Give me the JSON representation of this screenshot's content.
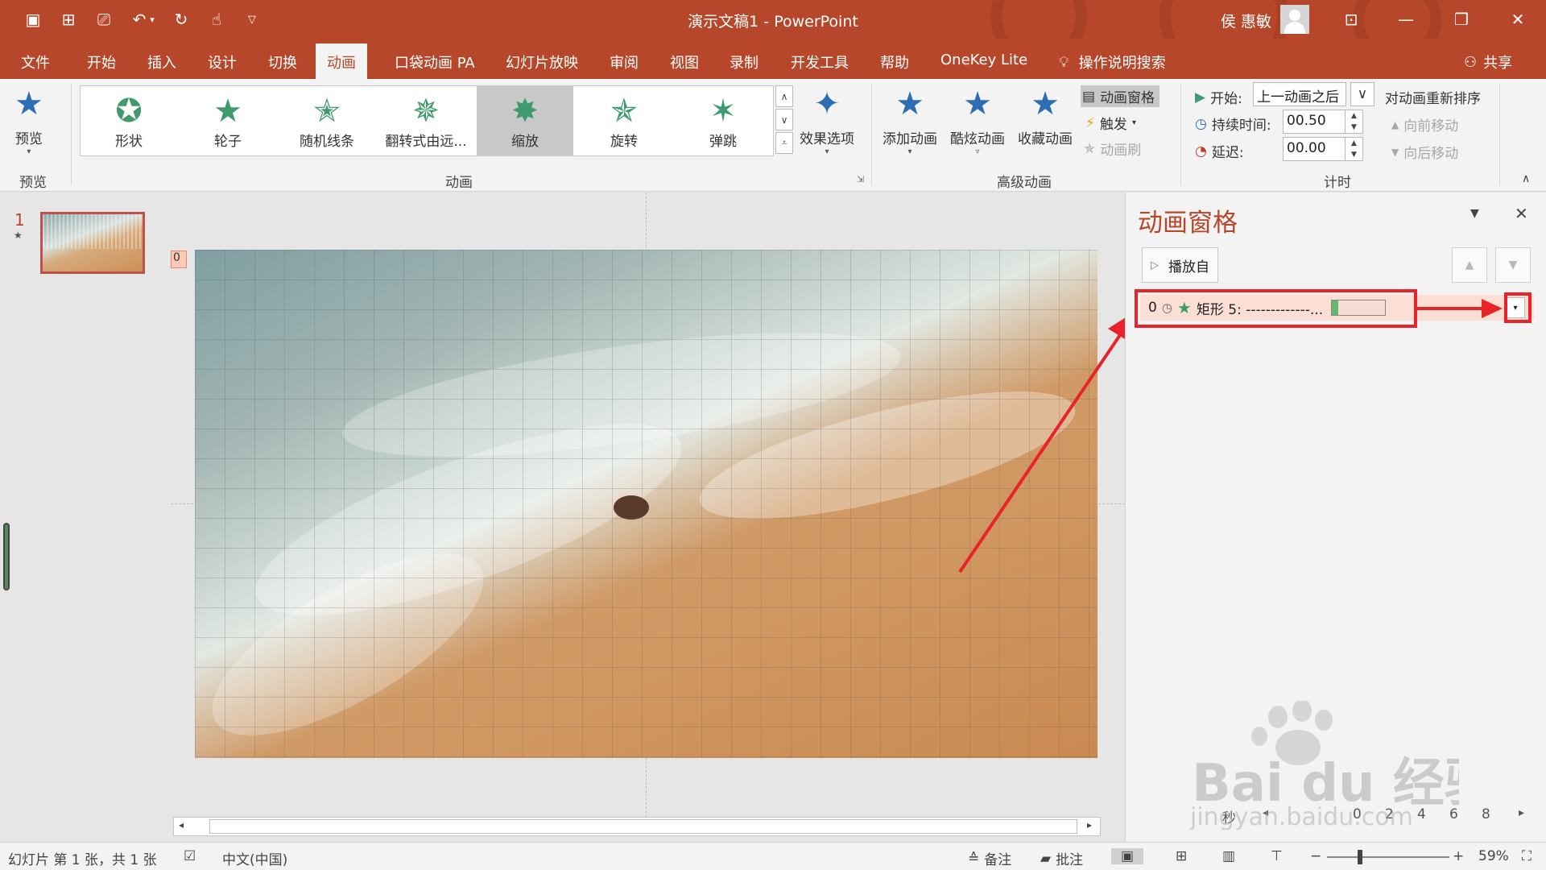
{
  "window": {
    "title": "演示文稿1 - PowerPoint",
    "user": "侯 惠敏"
  },
  "menu": {
    "tabs": [
      "文件",
      "开始",
      "插入",
      "设计",
      "切换",
      "动画",
      "口袋动画 PA",
      "幻灯片放映",
      "审阅",
      "视图",
      "录制",
      "开发工具",
      "帮助",
      "OneKey Lite"
    ],
    "active": "动画",
    "search": "操作说明搜索",
    "share": "共享"
  },
  "ribbon": {
    "preview_label": "预览",
    "preview_group": "预览",
    "gallery": [
      "形状",
      "轮子",
      "随机线条",
      "翻转式由远...",
      "缩放",
      "旋转",
      "弹跳"
    ],
    "gallery_selected": "缩放",
    "effect_options": "效果选项",
    "animation_group": "动画",
    "add_animation": "添加动画",
    "cool_animation": "酷炫动画",
    "fav_animation": "收藏动画",
    "anim_pane_btn": "动画窗格",
    "trigger": "触发",
    "anim_brush": "动画刷",
    "advanced_group": "高级动画",
    "start_label": "开始:",
    "start_value": "上一动画之后",
    "duration_label": "持续时间:",
    "duration_value": "00.50",
    "delay_label": "延迟:",
    "delay_value": "00.00",
    "timing_group": "计时",
    "reorder_title": "对动画重新排序",
    "move_earlier": "向前移动",
    "move_later": "向后移动"
  },
  "thumbnails": {
    "slide_number": "1",
    "anim_marker": "★"
  },
  "slide": {
    "anim_tag": "0"
  },
  "anim_pane": {
    "title": "动画窗格",
    "play_from": "播放自",
    "item": {
      "index": "0",
      "name": "矩形 5: -------------..."
    },
    "timeline": {
      "unit": "秒",
      "ticks": [
        "0",
        "2",
        "4",
        "6",
        "8"
      ]
    }
  },
  "status": {
    "slide_info": "幻灯片 第 1 张，共 1 张",
    "language": "中文(中国)",
    "notes": "备注",
    "comments": "批注",
    "zoom": "59%"
  },
  "colors": {
    "accent": "#b7472a",
    "highlight_red": "#e8232a",
    "anim_green": "#3f9b6d"
  }
}
